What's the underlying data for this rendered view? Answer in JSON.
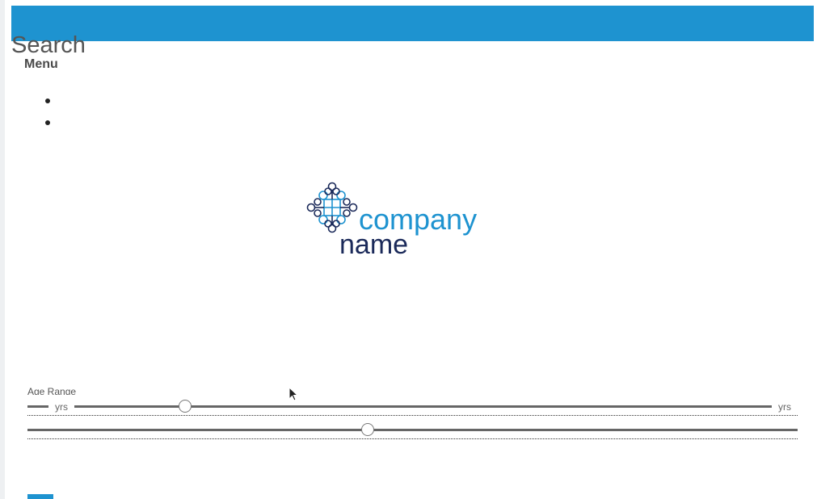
{
  "header": {
    "search_label": "Search",
    "menu_label": "Menu",
    "bar_color": "#1e93d0",
    "menu_items": [
      "",
      ""
    ]
  },
  "logo": {
    "word1": "company",
    "word2": "name",
    "accent_color": "#1e93d0",
    "dark_color": "#1b2a5a"
  },
  "age_range": {
    "label": "Age Range",
    "unit": "yrs",
    "min_slider_fraction": 0.205,
    "max_slider_fraction": 0.442
  },
  "icons": {
    "cursor": "mouse-pointer-icon",
    "logo": "knot-logo-icon"
  }
}
